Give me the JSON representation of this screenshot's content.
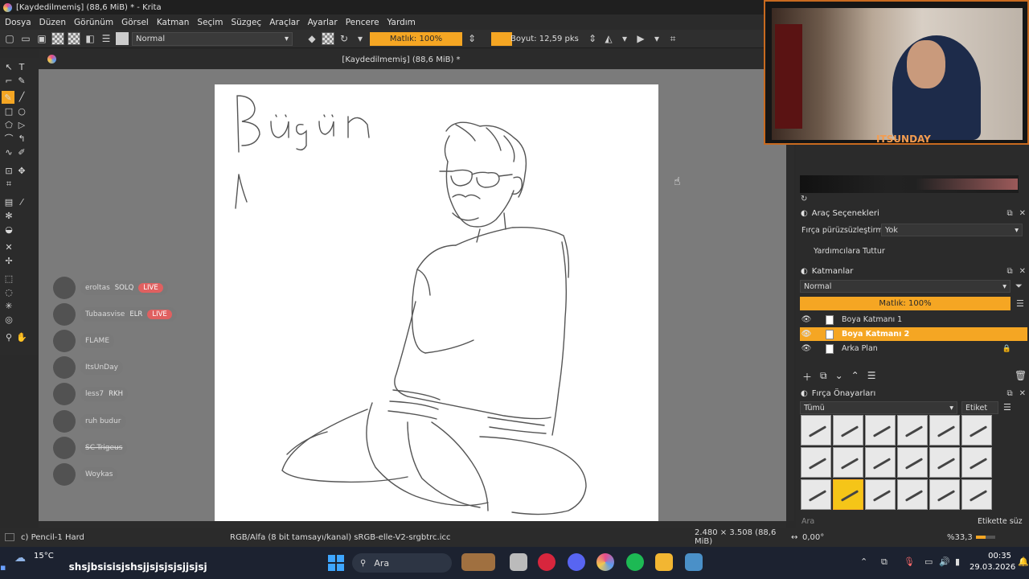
{
  "window": {
    "title": "[Kaydedilmemiş]  (88,6 MiB) * - Krita"
  },
  "menu": [
    "Dosya",
    "Düzen",
    "Görünüm",
    "Görsel",
    "Katman",
    "Seçim",
    "Süzgeç",
    "Araçlar",
    "Ayarlar",
    "Pencere",
    "Yardım"
  ],
  "toolbar": {
    "blend_mode": "Normal",
    "opacity_label": "Matlık: 100%",
    "size_label": "Boyut: 12,59 pks"
  },
  "document": {
    "tab_title": "[Kaydedilmemiş]  (88,6 MiB) *"
  },
  "canvas": {
    "handwriting": "Bügün"
  },
  "chat": [
    {
      "user": "eroltas",
      "badge": "SOLQ",
      "live": "LIVE"
    },
    {
      "user": "Tubaasvise",
      "badge": "ELR",
      "live": "LIVE"
    },
    {
      "user": "FLAME",
      "badge": "",
      "live": ""
    },
    {
      "user": "ItsUnDay",
      "badge": "",
      "live": ""
    },
    {
      "user": "less7",
      "badge": "RKH",
      "live": ""
    },
    {
      "user": "ruh budur",
      "badge": "",
      "live": ""
    },
    {
      "user": "SC-Trigeus",
      "badge": "",
      "live": ""
    },
    {
      "user": "Woykas",
      "badge": "",
      "live": ""
    }
  ],
  "webcam": {
    "channel_name": "ITSUNDAY"
  },
  "tool_options": {
    "title": "Araç Seçenekleri",
    "smoothing_label": "Fırça pürüzsüzleştirme:",
    "smoothing_value": "Yok",
    "snap_label": "Yardımcılara Tuttur"
  },
  "layers": {
    "title": "Katmanlar",
    "blend_mode": "Normal",
    "opacity_label": "Matlık:  100%",
    "items": [
      {
        "name": "Boya Katmanı 1",
        "active": false
      },
      {
        "name": "Boya Katmanı 2",
        "active": true
      },
      {
        "name": "Arka Plan",
        "active": false
      }
    ]
  },
  "brush_presets": {
    "title": "Fırça Önayarları",
    "filter_value": "Tümü",
    "tag_label": "Etiket",
    "search_placeholder": "Ara",
    "tag_filter_label": "Etikette süz"
  },
  "status": {
    "brush_name": "c) Pencil-1 Hard",
    "color_info": "RGB/Alfa (8 bit tamsayı/kanal) sRGB-elle-V2-srgbtrc.icc",
    "dimensions": "2.480 × 3.508 (88,6 MiB)",
    "rotation": "0,00°",
    "zoom": "%33,3"
  },
  "taskbar": {
    "weather_temp": "15°C",
    "search_placeholder": "Ara",
    "time": "00:35",
    "date": "29.03.2026",
    "ticker_text": "shsjbsisisjshsjjsjsjsjsjjsjsj"
  },
  "colors": {
    "accent": "#f5a623",
    "background": "#2b2b2b",
    "canvas_bg": "#7b7b7b"
  }
}
